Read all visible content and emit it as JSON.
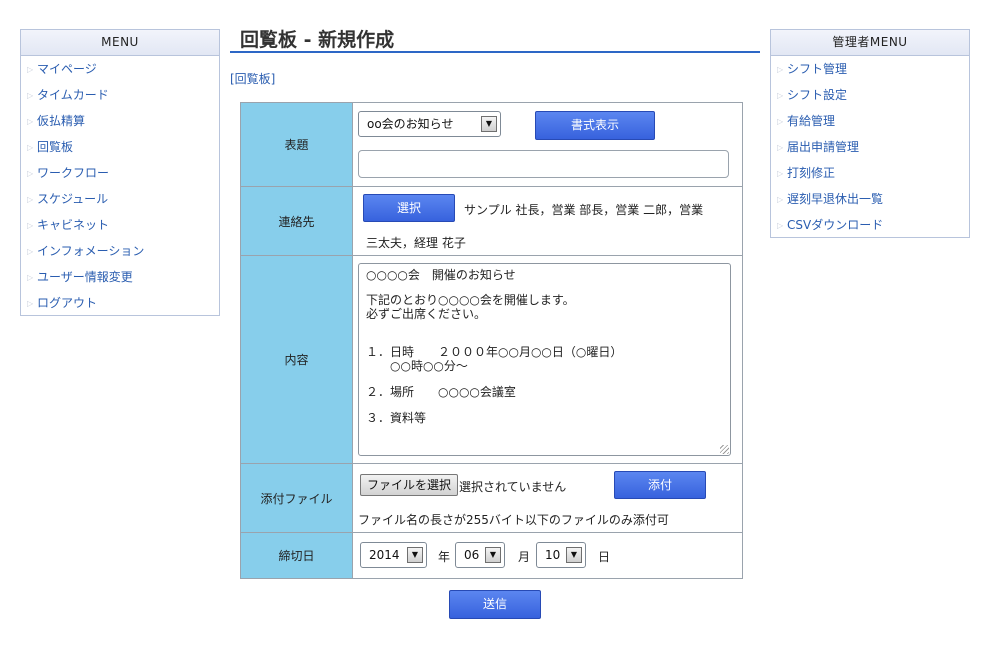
{
  "left_menu": {
    "header": "MENU",
    "items": [
      "マイページ",
      "タイムカード",
      "仮払精算",
      "回覧板",
      "ワークフロー",
      "スケジュール",
      "キャビネット",
      "インフォメーション",
      "ユーザー情報変更",
      "ログアウト"
    ]
  },
  "right_menu": {
    "header": "管理者MENU",
    "items": [
      "シフト管理",
      "シフト設定",
      "有給管理",
      "届出申請管理",
      "打刻修正",
      "遅刻早退休出一覧",
      "CSVダウンロード"
    ]
  },
  "page": {
    "title": "回覧板 - 新規作成",
    "breadcrumb": "[回覧板]"
  },
  "form": {
    "subject": {
      "label": "表題",
      "template_value": "oo会のお知らせ",
      "format_button": "書式表示",
      "title_value": ""
    },
    "recipients": {
      "label": "連絡先",
      "select_button": "選択",
      "line1": "サンプル 社長，営業 部長，営業 二郎，営業",
      "line2": "三太夫，経理 花子"
    },
    "content": {
      "label": "内容",
      "lines": [
        "○○○○会　開催のお知らせ",
        "",
        "下記のとおり○○○○会を開催します。",
        "必ずご出席ください。",
        "",
        "",
        "１．日時　　２０００年○○月○○日（○曜日）",
        "　　○○時○○分～",
        "",
        "２．場所　　○○○○会議室",
        "",
        "３．資料等"
      ]
    },
    "attachment": {
      "label": "添付ファイル",
      "choose_button": "ファイルを選択",
      "status": "選択されていません",
      "attach_button": "添付",
      "note": "ファイル名の長さが255バイト以下のファイルのみ添付可"
    },
    "deadline": {
      "label": "締切日",
      "year": "2014",
      "year_unit": "年",
      "month": "06",
      "month_unit": "月",
      "day": "10",
      "day_unit": "日"
    },
    "submit_button": "送信"
  },
  "icons": {
    "menu_arrow": "triangle-right-icon",
    "dropdown": "chevron-down-icon"
  },
  "colors": {
    "accent_blue": "#3762dd",
    "label_bg": "#87ceeb",
    "link": "#2a5db0"
  }
}
